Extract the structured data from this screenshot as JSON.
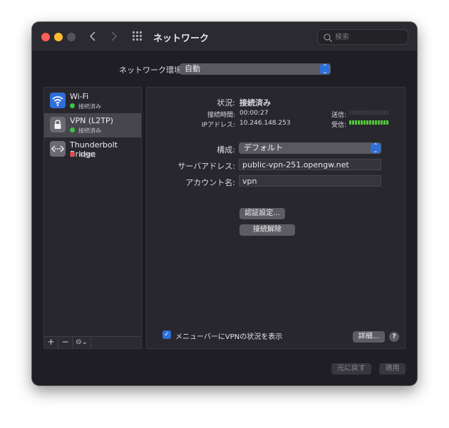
{
  "window": {
    "title": "ネットワーク"
  },
  "search": {
    "placeholder": "検索"
  },
  "location": {
    "label": "ネットワーク環境:",
    "value": "自動"
  },
  "services": [
    {
      "name": "Wi-Fi",
      "status": "接続済み",
      "status_color": "#3fc150",
      "icon": "wifi-icon"
    },
    {
      "name": "VPN (L2TP)",
      "status": "接続済み",
      "status_color": "#3fc150",
      "icon": "lock-icon"
    },
    {
      "name": "Thunderbolt Bridge",
      "status": "未接続",
      "status_color": "#e24a42",
      "icon": "thunderbolt-bridge-icon"
    }
  ],
  "sidebar_footer": {
    "add": "+",
    "remove": "−",
    "action": "⊝⌄"
  },
  "detail": {
    "status_label": "状況:",
    "status_value": "接続済み",
    "connect_time_label": "接続時間:",
    "connect_time_value": "00:00:27",
    "ip_label": "IPアドレス:",
    "ip_value": "10.246.148.253",
    "send_label": "送信:",
    "recv_label": "受信:",
    "config_label": "構成:",
    "config_value": "デフォルト",
    "server_label": "サーバアドレス:",
    "server_value": "public-vpn-251.opengw.net",
    "account_label": "アカウント名:",
    "account_value": "vpn",
    "auth_button": "認証設定...",
    "disconnect_button": "接続解除",
    "menu_checkbox_label": "メニューバーにVPNの状況を表示",
    "advanced_button": "詳細...",
    "help": "?"
  },
  "footer": {
    "revert": "元に戻す",
    "apply": "適用"
  },
  "colors": {
    "accent": "#2f6fd9",
    "connected": "#3fc150",
    "disconnected": "#e24a42"
  }
}
